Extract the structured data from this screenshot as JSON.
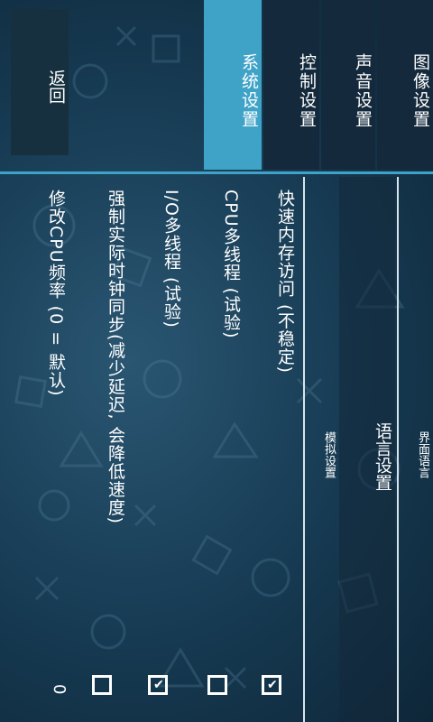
{
  "tabs": [
    {
      "label": "图像设置",
      "active": false
    },
    {
      "label": "声音设置",
      "active": false
    },
    {
      "label": "控制设置",
      "active": false
    },
    {
      "label": "系统设置",
      "active": true
    }
  ],
  "back_label": "返回",
  "side_nav": {
    "ui_language": "界面语言",
    "language_settings": "语言设置",
    "emulation_settings": "模拟设置"
  },
  "settings": [
    {
      "label": "快速内存访问 (不稳定)",
      "type": "checkbox",
      "checked": true
    },
    {
      "label": "CPU多线程 (试验)",
      "type": "checkbox",
      "checked": false
    },
    {
      "label": "I/O多线程 (试验)",
      "type": "checkbox",
      "checked": true
    },
    {
      "label": "强制实际时钟同步(减少延迟, 会降低速度)",
      "type": "checkbox",
      "checked": false
    },
    {
      "label": "修改CPU频率 (0 = 默认)",
      "type": "value",
      "value": "0"
    }
  ],
  "colors": {
    "accent": "#3fa3c8",
    "tab_bg": "#142a3c",
    "bg": "#163a52"
  }
}
